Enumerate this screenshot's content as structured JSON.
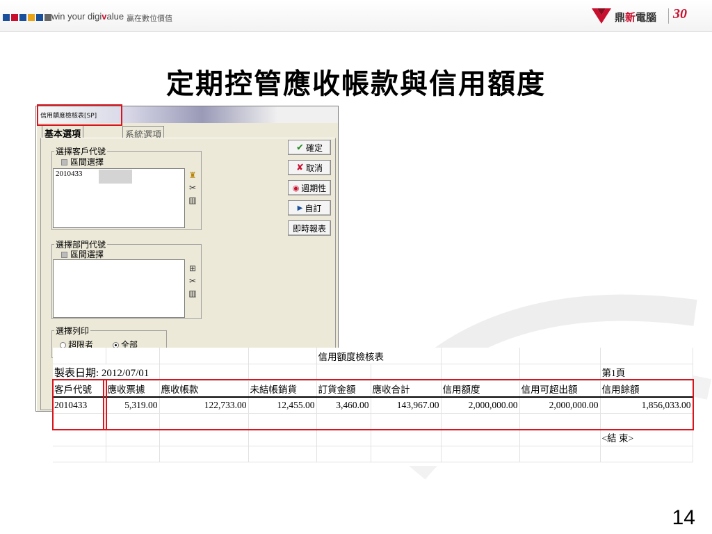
{
  "header": {
    "tagline_pre": "win your digi",
    "tagline_v": "v",
    "tagline_post": "alue",
    "tagline_cn": "贏在數位價值",
    "brand_name_1": "鼎",
    "brand_name_2": "新",
    "brand_name_3": "電腦",
    "brand_30": "30"
  },
  "slide_title": "定期控管應收帳款與信用額度",
  "dialog": {
    "title": "信用額度檢核表[SP]",
    "tabs": [
      "基本選項",
      "系統選項"
    ],
    "customer_group": {
      "label": "選擇客戶代號",
      "range_checkbox": "區間選擇",
      "value": "2010433"
    },
    "dept_group": {
      "label": "選擇部門代號",
      "range_checkbox": "區間選擇"
    },
    "print_group": {
      "label": "選擇列印",
      "options": [
        "超限者",
        "全部"
      ],
      "selected": "全部"
    },
    "buttons": {
      "confirm": "確定",
      "cancel": "取消",
      "periodic": "週期性",
      "custom": "自訂",
      "instant_report": "即時報表"
    }
  },
  "report": {
    "title": "信用額度檢核表",
    "date_label": "製表日期:",
    "date_value": "2012/07/01",
    "page_label": "第1頁",
    "columns": [
      "客戶代號",
      "應收票據",
      "應收帳款",
      "未結帳銷貨",
      "訂貨金額",
      "應收合計",
      "信用額度",
      "信用可超出額",
      "信用餘額"
    ],
    "row": [
      "2010433",
      "5,319.00",
      "122,733.00",
      "12,455.00",
      "3,460.00",
      "143,967.00",
      "2,000,000.00",
      "2,000,000.00",
      "1,856,033.00"
    ],
    "end_label": "<結  束>"
  },
  "page_number": "14",
  "colors": {
    "accent_red": "#d8141c",
    "brand_red": "#c8102e",
    "header_squares": [
      "#1a4f9c",
      "#c8102e",
      "#1a4f9c",
      "#e8a317",
      "#1a4f9c",
      "#666666"
    ]
  }
}
